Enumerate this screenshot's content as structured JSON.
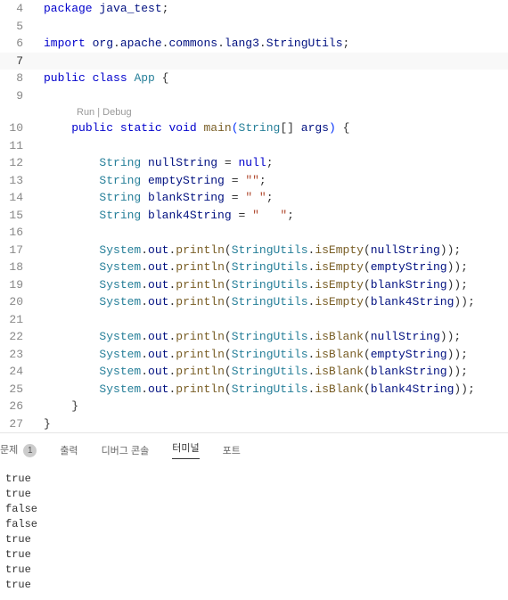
{
  "editor": {
    "lines": [
      {
        "no": 4,
        "hl": false
      },
      {
        "no": 5,
        "hl": false
      },
      {
        "no": 6,
        "hl": false
      },
      {
        "no": 7,
        "hl": false,
        "cursor": true
      },
      {
        "no": 8,
        "hl": false
      },
      {
        "no": 9,
        "hl": false
      },
      {
        "no": 10,
        "hl": true
      },
      {
        "no": 11,
        "hl": true
      },
      {
        "no": 12,
        "hl": true
      },
      {
        "no": 13,
        "hl": true
      },
      {
        "no": 14,
        "hl": true
      },
      {
        "no": 15,
        "hl": true
      },
      {
        "no": 16,
        "hl": true
      },
      {
        "no": 17,
        "hl": true
      },
      {
        "no": 18,
        "hl": true
      },
      {
        "no": 19,
        "hl": true
      },
      {
        "no": 20,
        "hl": true
      },
      {
        "no": 21,
        "hl": true
      },
      {
        "no": 22,
        "hl": true
      },
      {
        "no": 23,
        "hl": true
      },
      {
        "no": 24,
        "hl": true
      },
      {
        "no": 25,
        "hl": true
      },
      {
        "no": 26,
        "hl": true
      },
      {
        "no": 27,
        "hl": false
      }
    ],
    "tokens": {
      "package": "package",
      "pkg_name": "java_test",
      "import": "import",
      "import_path_org": "org",
      "import_path_apache": "apache",
      "import_path_commons": "commons",
      "import_path_lang3": "lang3",
      "import_path_class": "StringUtils",
      "public": "public",
      "class": "class",
      "app": "App",
      "static": "static",
      "void": "void",
      "main": "main",
      "string": "String",
      "args": "args",
      "nullString": "nullString",
      "emptyString": "emptyString",
      "blankString": "blankString",
      "blank4String": "blank4String",
      "null": "null",
      "empty_lit": "\"\"",
      "blank_lit": "\" \"",
      "blank4_lit": "\"   \"",
      "system": "System",
      "out": "out",
      "println": "println",
      "stringUtils": "StringUtils",
      "isEmpty": "isEmpty",
      "isBlank": "isBlank"
    },
    "codelens": {
      "run": "Run",
      "debug": "Debug",
      "sep": " | "
    }
  },
  "panel": {
    "tabs": {
      "problems": "문제",
      "problems_count": "1",
      "output": "출력",
      "debug_console": "디버그 콘솔",
      "terminal": "터미널",
      "ports": "포트"
    }
  },
  "terminal": {
    "lines": [
      "true",
      "true",
      "false",
      "false",
      "true",
      "true",
      "true",
      "true"
    ]
  }
}
